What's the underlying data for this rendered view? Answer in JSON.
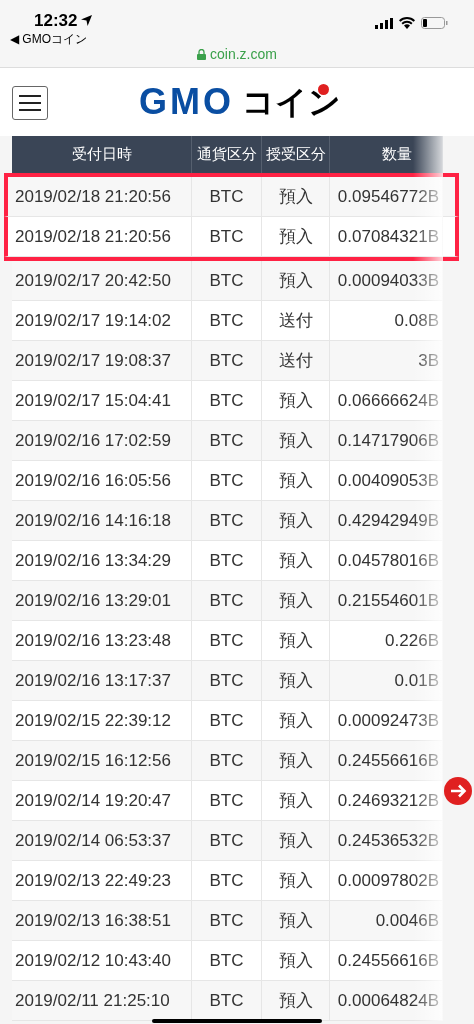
{
  "status_bar": {
    "time": "12:32",
    "back_app": "◀ GMOコイン"
  },
  "url_bar": {
    "url": "coin.z.com"
  },
  "header": {
    "logo_latin": "GMO",
    "logo_kana": "コイン"
  },
  "table": {
    "columns": [
      "受付日時",
      "通貨区分",
      "授受区分",
      "数量"
    ],
    "rows": [
      {
        "cells": [
          "2019/02/18 21:20:56",
          "BTC",
          "預入",
          "0.09546772B"
        ],
        "highlighted": true
      },
      {
        "cells": [
          "2019/02/18 21:20:56",
          "BTC",
          "預入",
          "0.07084321B"
        ],
        "highlighted": true
      },
      {
        "cells": [
          "2019/02/17 20:42:50",
          "BTC",
          "預入",
          "0.00094033B"
        ],
        "highlighted": false
      },
      {
        "cells": [
          "2019/02/17 19:14:02",
          "BTC",
          "送付",
          "0.08B"
        ],
        "highlighted": false
      },
      {
        "cells": [
          "2019/02/17 19:08:37",
          "BTC",
          "送付",
          "3B"
        ],
        "highlighted": false
      },
      {
        "cells": [
          "2019/02/17 15:04:41",
          "BTC",
          "預入",
          "0.06666624B"
        ],
        "highlighted": false
      },
      {
        "cells": [
          "2019/02/16 17:02:59",
          "BTC",
          "預入",
          "0.14717906B"
        ],
        "highlighted": false
      },
      {
        "cells": [
          "2019/02/16 16:05:56",
          "BTC",
          "預入",
          "0.00409053B"
        ],
        "highlighted": false
      },
      {
        "cells": [
          "2019/02/16 14:16:18",
          "BTC",
          "預入",
          "0.42942949B"
        ],
        "highlighted": false
      },
      {
        "cells": [
          "2019/02/16 13:34:29",
          "BTC",
          "預入",
          "0.04578016B"
        ],
        "highlighted": false
      },
      {
        "cells": [
          "2019/02/16 13:29:01",
          "BTC",
          "預入",
          "0.21554601B"
        ],
        "highlighted": false
      },
      {
        "cells": [
          "2019/02/16 13:23:48",
          "BTC",
          "預入",
          "0.226B"
        ],
        "highlighted": false
      },
      {
        "cells": [
          "2019/02/16 13:17:37",
          "BTC",
          "預入",
          "0.01B"
        ],
        "highlighted": false
      },
      {
        "cells": [
          "2019/02/15 22:39:12",
          "BTC",
          "預入",
          "0.00092473B"
        ],
        "highlighted": false
      },
      {
        "cells": [
          "2019/02/15 16:12:56",
          "BTC",
          "預入",
          "0.24556616B"
        ],
        "highlighted": false
      },
      {
        "cells": [
          "2019/02/14 19:20:47",
          "BTC",
          "預入",
          "0.24693212B"
        ],
        "highlighted": false
      },
      {
        "cells": [
          "2019/02/14 06:53:37",
          "BTC",
          "預入",
          "0.24536532B"
        ],
        "highlighted": false
      },
      {
        "cells": [
          "2019/02/13 22:49:23",
          "BTC",
          "預入",
          "0.00097802B"
        ],
        "highlighted": false
      },
      {
        "cells": [
          "2019/02/13 16:38:51",
          "BTC",
          "預入",
          "0.0046B"
        ],
        "highlighted": false
      },
      {
        "cells": [
          "2019/02/12 10:43:40",
          "BTC",
          "預入",
          "0.24556616B"
        ],
        "highlighted": false
      },
      {
        "cells": [
          "2019/02/11 21:25:10",
          "BTC",
          "預入",
          "0.00064824B"
        ],
        "highlighted": false
      }
    ]
  }
}
